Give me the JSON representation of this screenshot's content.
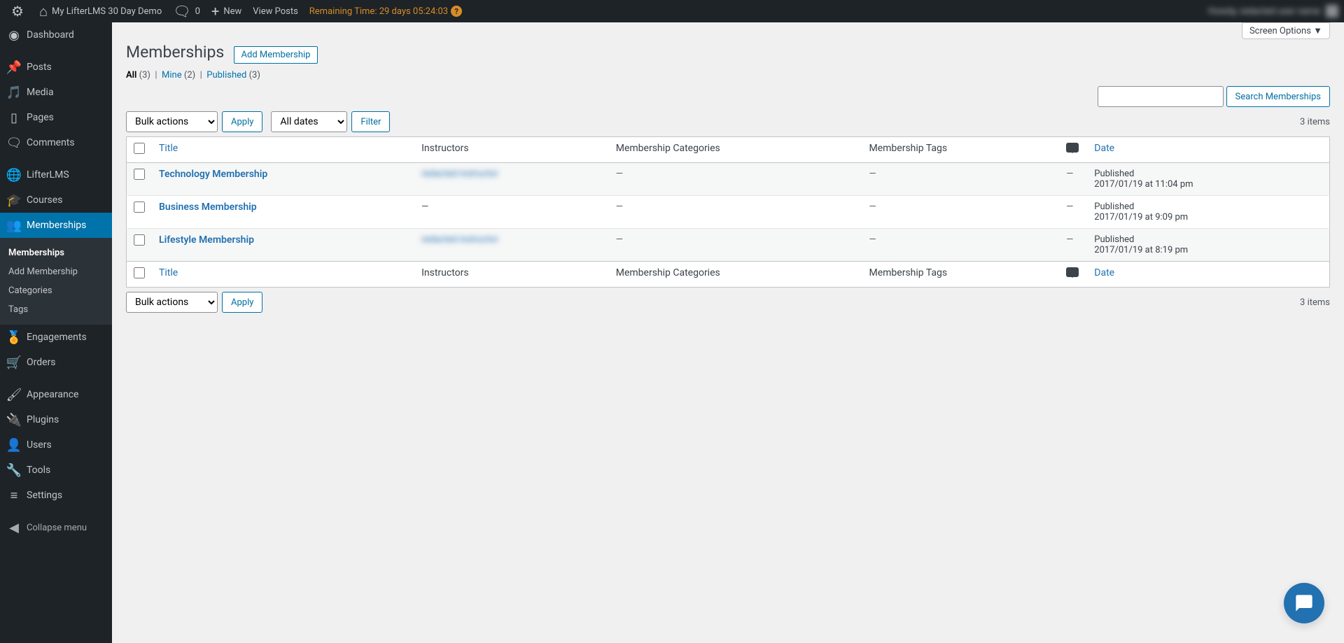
{
  "adminbar": {
    "site_name": "My LifterLMS 30 Day Demo",
    "comments": "0",
    "new": "New",
    "view_posts": "View Posts",
    "remaining": "Remaining Time: 29 days 05:24:03",
    "howdy": "Howdy, redacted user name"
  },
  "sidebar": {
    "dashboard": "Dashboard",
    "posts": "Posts",
    "media": "Media",
    "pages": "Pages",
    "comments": "Comments",
    "lifterlms": "LifterLMS",
    "courses": "Courses",
    "memberships": "Memberships",
    "submenu": {
      "memberships": "Memberships",
      "add_membership": "Add Membership",
      "categories": "Categories",
      "tags": "Tags"
    },
    "engagements": "Engagements",
    "orders": "Orders",
    "appearance": "Appearance",
    "plugins": "Plugins",
    "users": "Users",
    "tools": "Tools",
    "settings": "Settings",
    "collapse": "Collapse menu"
  },
  "page": {
    "screen_options": "Screen Options",
    "title": "Memberships",
    "add_button": "Add Membership",
    "filters": {
      "all": "All",
      "all_count": "(3)",
      "mine": "Mine",
      "mine_count": "(2)",
      "published": "Published",
      "published_count": "(3)"
    },
    "search_button": "Search Memberships",
    "bulk_actions": "Bulk actions",
    "apply": "Apply",
    "all_dates": "All dates",
    "filter": "Filter",
    "items_count": "3 items"
  },
  "table": {
    "headers": {
      "title": "Title",
      "instructors": "Instructors",
      "categories": "Membership Categories",
      "tags": "Membership Tags",
      "date": "Date"
    },
    "rows": [
      {
        "title": "Technology Membership",
        "instructor": "redacted instructor",
        "categories": "—",
        "tags": "—",
        "comments": "—",
        "status": "Published",
        "date": "2017/01/19 at 11:04 pm",
        "blur": true
      },
      {
        "title": "Business Membership",
        "instructor": "—",
        "categories": "—",
        "tags": "—",
        "comments": "—",
        "status": "Published",
        "date": "2017/01/19 at 9:09 pm",
        "blur": false
      },
      {
        "title": "Lifestyle Membership",
        "instructor": "redacted instructor",
        "categories": "—",
        "tags": "—",
        "comments": "—",
        "status": "Published",
        "date": "2017/01/19 at 8:19 pm",
        "blur": true
      }
    ]
  }
}
